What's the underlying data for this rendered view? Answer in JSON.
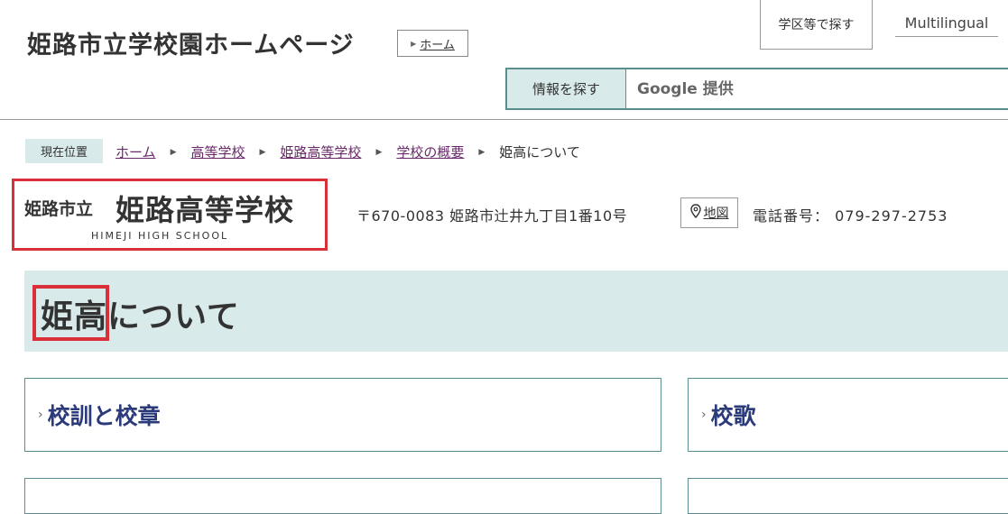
{
  "header": {
    "site_title": "姫路市立学校園ホームページ",
    "home_button": "ホーム",
    "district_button": "学区等で探す",
    "multilingual_button": "Multilingual",
    "search_label": "情報を探す",
    "search_placeholder": "Google 提供"
  },
  "breadcrumb": {
    "label": "現在位置",
    "items": [
      "ホーム",
      "高等学校",
      "姫路高等学校",
      "学校の概要"
    ],
    "current": "姫高について"
  },
  "school": {
    "prefix": "姫路市立",
    "name": "姫路高等学校",
    "name_en": "HIMEJI HIGH SCHOOL",
    "address": "〒670-0083 姫路市辻井九丁目1番10号",
    "map_button": "地図",
    "phone": "電話番号： 079-297-2753"
  },
  "page": {
    "title": "姫高について"
  },
  "cards": [
    {
      "label": "校訓と校章"
    },
    {
      "label": "校歌"
    },
    {
      "label": ""
    },
    {
      "label": ""
    }
  ],
  "colors": {
    "accent_light": "#d9eaea",
    "border_teal": "#5b8f8f",
    "highlight_red": "#d9303a",
    "link_purple": "#6a2a6a",
    "card_text": "#2a3a7a"
  },
  "icons": {
    "map": "map-pin-icon",
    "chevron": "chevron-right-icon"
  }
}
